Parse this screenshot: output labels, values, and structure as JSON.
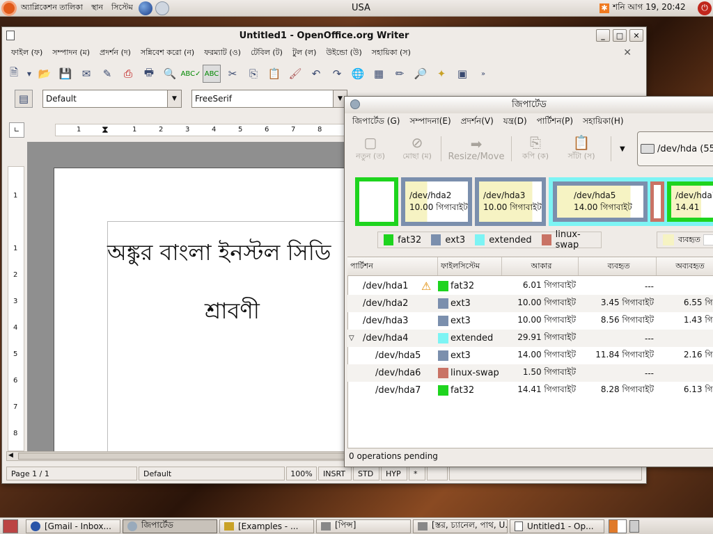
{
  "top_panel": {
    "menus": [
      "অ্যাপ্লিকেশন তালিকা",
      "স্থান",
      "সিস্টেম"
    ],
    "locale": "USA",
    "clock": "শনি আগ 19, 20:42"
  },
  "writer": {
    "title": "Untitled1 - OpenOffice.org Writer",
    "menus": [
      "ফাইল (ফ)",
      "সম্পাদন (ম)",
      "প্রদর্শন (দ)",
      "সন্নিবেশ করো (ন)",
      "ফরম্যাট (ও)",
      "টেবিল (ট)",
      "টুল (ল)",
      "উইন্ডো (উ)",
      "সহায়িকা (স)"
    ],
    "style": "Default",
    "font": "FreeSerif",
    "doc_line1": "অঙ্কুর বাংলা ইনস্টল সিডি",
    "doc_line2": "শ্রাবণী",
    "ruler_numbers": [
      "1",
      "1",
      "2",
      "3",
      "4",
      "5",
      "6",
      "7",
      "8"
    ],
    "vruler_numbers": [
      "1",
      "1",
      "2",
      "3",
      "4",
      "5",
      "6",
      "7",
      "8"
    ],
    "status": {
      "page": "Page 1 / 1",
      "style": "Default",
      "zoom": "100%",
      "insert": "INSRT",
      "selection": "STD",
      "hyp": "HYP",
      "modified": "*"
    }
  },
  "gparted": {
    "title": "জিপার্টেড",
    "menus": [
      "জিপার্টেড (G)",
      "সম্পাদনা(E)",
      "প্রদর্শন(V)",
      "যন্ত্র(D)",
      "পার্টিশন(P)",
      "সহায়িকা(H)"
    ],
    "toolbar": {
      "new": "নতুন (ত)",
      "delete": "মোছা (ম)",
      "resize": "Resize/Move",
      "copy": "কপি (ক)",
      "paste": "সাঁটা (স)"
    },
    "device": "/dev/hda  (55",
    "map": [
      {
        "name": "/dev/hda2",
        "size": "10.00 গিগাবাইট"
      },
      {
        "name": "/dev/hda3",
        "size": "10.00 গিগাবাইট"
      },
      {
        "name": "/dev/hda5",
        "size": "14.00 গিগাবাইট"
      },
      {
        "name": "/dev/hda7",
        "size": "14.41"
      }
    ],
    "legend": [
      "fat32",
      "ext3",
      "extended",
      "linux-swap"
    ],
    "legend_usage": [
      "ব্যবহৃত"
    ],
    "colors": {
      "fat32": "#1ed41e",
      "ext3": "#7b8fad",
      "extended": "#7df4f4",
      "linux-swap": "#c97365",
      "used": "#f6f3c3"
    },
    "columns": [
      "পার্টিশন",
      "ফাইলসিস্টেম",
      "আকার",
      "ব্যবহৃত",
      "অব্যবহৃত"
    ],
    "rows": [
      {
        "partition": "/dev/hda1",
        "fs": "fat32",
        "size": "6.01 গিগাবাইট",
        "used": "---",
        "unused": "",
        "warn": true
      },
      {
        "partition": "/dev/hda2",
        "fs": "ext3",
        "size": "10.00 গিগাবাইট",
        "used": "3.45 গিগাবাইট",
        "unused": "6.55 গিগা"
      },
      {
        "partition": "/dev/hda3",
        "fs": "ext3",
        "size": "10.00 গিগাবাইট",
        "used": "8.56 গিগাবাইট",
        "unused": "1.43 গিগা"
      },
      {
        "partition": "/dev/hda4",
        "fs": "extended",
        "size": "29.91 গিগাবাইট",
        "used": "---",
        "unused": ""
      },
      {
        "partition": "/dev/hda5",
        "fs": "ext3",
        "size": "14.00 গিগাবাইট",
        "used": "11.84 গিগাবাইট",
        "unused": "2.16 গিগা"
      },
      {
        "partition": "/dev/hda6",
        "fs": "linux-swap",
        "size": "1.50 গিগাবাইট",
        "used": "---",
        "unused": ""
      },
      {
        "partition": "/dev/hda7",
        "fs": "fat32",
        "size": "14.41 গিগাবাইট",
        "used": "8.28 গিগাবাইট",
        "unused": "6.13 গিগা"
      }
    ],
    "pending": "0 operations pending"
  },
  "taskbar": [
    "[Gmail - Inbox...",
    "জিপার্টেড",
    "[Examples - ...",
    "[পিন্স]",
    "[স্তর, চ্যানেল, পাথ, U...",
    "Untitled1 - Op..."
  ]
}
